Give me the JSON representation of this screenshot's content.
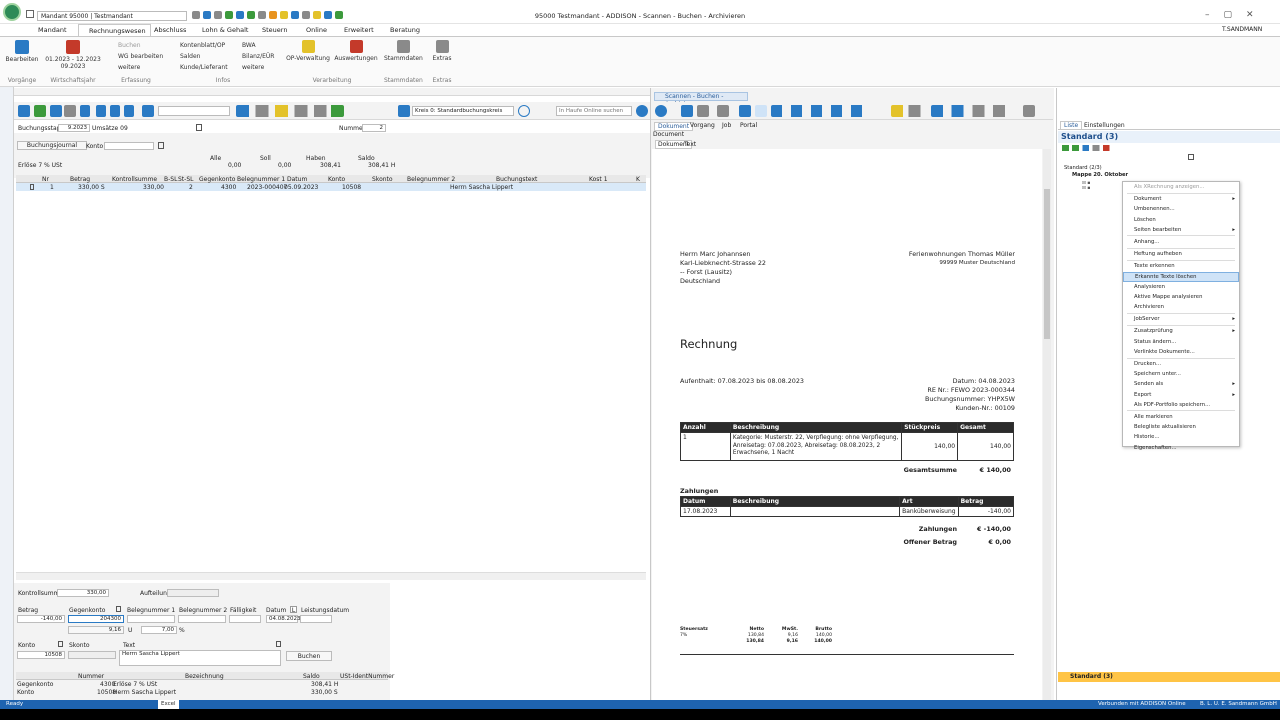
{
  "window": {
    "title": "95000 Testmandant - ADDISON - Scannen - Buchen - Archivieren",
    "mandant_field": "Mandant 95000  |  Testmandant",
    "user": "T.SANDMANN"
  },
  "tabs": [
    "Mandant",
    "Rechnungswesen",
    "Abschluss",
    "Lohn & Gehalt",
    "Steuern",
    "Online",
    "Erweitert",
    "Beratung"
  ],
  "ribbon": {
    "bearbeiten": "Bearbeiten",
    "vorgaenge": "Vorgänge",
    "period": "01.2023 - 12.2023",
    "period_sub": "09.2023",
    "wj": "Wirtschaftsjahr",
    "buchen": "Buchen",
    "wg": "WG bearbeiten",
    "weitere1": "weitere",
    "erfassung": "Erfassung",
    "kontenblatt": "Kontenblatt/OP",
    "salden": "Salden",
    "kunde": "Kunde/Lieferant",
    "bwa": "BWA",
    "bilanz": "Bilanz/EÜR",
    "weitere2": "weitere",
    "infos": "Infos",
    "opv": "OP-Verwaltung",
    "auswertungen": "Auswertungen",
    "verarbeitung": "Verarbeitung",
    "stammdaten": "Stammdaten",
    "stammdaten_grp": "Stammdaten",
    "extras": "Extras",
    "extras_grp": "Extras"
  },
  "left": {
    "kreis": "Kreis 0: Standardbuchungskreis",
    "search_placeholder": "In Haufe Online suchen",
    "stapel_label": "Buchungsstapel",
    "stapel_value": "9.2023",
    "stapel_name": "Umsätze 09",
    "nummer_label": "Nummer",
    "nummer_value": "2",
    "journal_btn": "Buchungsjournal",
    "konto_label": "Konto",
    "sum_headers": [
      "Alle",
      "Soll",
      "Haben",
      "Saldo"
    ],
    "sum_row_label": "Erlöse 7 % USt",
    "sum_values": [
      "0,00",
      "0,00",
      "308,41",
      "308,41 H"
    ],
    "cols": [
      "Nr",
      "Betrag",
      "Kontrollsumme",
      "B-SL",
      "St-SL",
      "Gegenkonto",
      "Belegnummer 1",
      "Datum",
      "Konto",
      "Skonto",
      "Belegnummer 2",
      "Buchungstext",
      "Kost 1",
      "K"
    ],
    "row": [
      "1",
      "330,00 S",
      "330,00",
      "2",
      "4300",
      "2023-000407",
      "05.09.2023",
      "10508",
      "",
      "",
      "Herrn Sascha Lippert"
    ],
    "kontrollsumme_label": "Kontrollsumme",
    "kontrollsumme_value": "330,00",
    "aufteilung_label": "Aufteilung",
    "form_labels": [
      "Betrag",
      "Gegenkonto",
      "Belegnummer 1",
      "Belegnummer 2",
      "Fälligkeit",
      "Datum",
      "L",
      "Leistungsdatum"
    ],
    "form_betrag": "-140,00",
    "form_gegenkonto": "204300",
    "form_datum": "04.08.2023",
    "form_ust": "9,16",
    "form_u": "U",
    "form_pct": "7,00",
    "form_pct_sign": "%",
    "konto_lbl": "Konto",
    "skonto_lbl": "Skonto",
    "text_lbl": "Text",
    "konto_val": "10508",
    "text_val": "Herrn Sascha Lippert",
    "buchen_btn": "Buchen",
    "info_headers": [
      "Nummer",
      "Bezeichnung",
      "Saldo",
      "USt-IdentNummer"
    ],
    "info_rows": [
      [
        "Gegenkonto",
        "4300",
        "Erlöse 7 % USt",
        "308,41 H"
      ],
      [
        "Konto",
        "10508",
        "Herrn Sascha Lippert",
        "330,00 S"
      ]
    ]
  },
  "doc": {
    "title": "Scannen - Buchen - Archivieren",
    "tabs": [
      "Dokument",
      "Vorgang",
      "Job",
      "Portal"
    ],
    "sub": "Document",
    "subtabs": [
      "Dokument",
      "Text"
    ],
    "to_name": "Herrn Marc Johannsen",
    "to_street": "Karl-Liebknecht-Strasse 22",
    "to_city": "-- Forst (Lausitz)",
    "to_country": "Deutschland",
    "from_name": "Ferienwohnungen Thomas Müller",
    "from_city": "99999 Muster Deutschland",
    "heading": "Rechnung",
    "stay": "Aufenthalt: 07.08.2023 bis 08.08.2023",
    "date": "Datum: 04.08.2023",
    "re_nr": "RE Nr.: FEWO 2023-000344",
    "buchungsnr": "Buchungsnummer: YHPX5W",
    "kunden": "Kunden-Nr.: 00109",
    "t_headers": [
      "Anzahl",
      "Beschreibung",
      "Stückpreis",
      "Gesamt"
    ],
    "t_row": [
      "1",
      "Kategorie: Musterstr. 22, Verpflegung: ohne Verpflegung, Anreisetag: 07.08.2023, Abreisetag: 08.08.2023, 2 Erwachsene, 1 Nacht",
      "140,00",
      "140,00"
    ],
    "gesamt_label": "Gesamtsumme",
    "gesamt": "€ 140,00",
    "zahlungen": "Zahlungen",
    "z_headers": [
      "Datum",
      "Beschreibung",
      "Art",
      "Betrag"
    ],
    "z_row": [
      "17.08.2023",
      "",
      "Banküberweisung",
      "-140,00"
    ],
    "zahl_label": "Zahlungen",
    "zahl_val": "€ -140,00",
    "offen_label": "Offener Betrag",
    "offen_val": "€ 0,00",
    "tax_headers": [
      "Steuersatz",
      "Netto",
      "MwSt.",
      "Brutto"
    ],
    "tax_row": [
      "7%",
      "130,84",
      "9,16",
      "140,00"
    ],
    "tax_total": [
      "",
      "130,84",
      "9,16",
      "140,00"
    ]
  },
  "right": {
    "tabs": [
      "Liste",
      "Einstellungen"
    ],
    "title": "Standard (3)",
    "tree_root": "Standard (2/3)",
    "tree_folder": "Mappe 20. Oktober",
    "bottom": "Standard (3)",
    "menu": [
      {
        "t": "Als XRechnung anzeigen...",
        "d": true
      },
      {
        "t": "sep"
      },
      {
        "t": "Dokument",
        "a": true
      },
      {
        "t": "Umbenennen..."
      },
      {
        "t": "Löschen"
      },
      {
        "t": "Seiten bearbeiten",
        "a": true
      },
      {
        "t": "sep"
      },
      {
        "t": "Anhang..."
      },
      {
        "t": "sep"
      },
      {
        "t": "Heftung aufheben"
      },
      {
        "t": "sep"
      },
      {
        "t": "Texte erkennen"
      },
      {
        "t": "Erkannte Texte löschen",
        "s": true
      },
      {
        "t": "Analysieren"
      },
      {
        "t": "Aktive Mappe analysieren"
      },
      {
        "t": "Archivieren"
      },
      {
        "t": "sep"
      },
      {
        "t": "JobServer",
        "a": true
      },
      {
        "t": "sep"
      },
      {
        "t": "Zusatzprüfung",
        "a": true
      },
      {
        "t": "Status ändern..."
      },
      {
        "t": "Verlinkte Dokumente..."
      },
      {
        "t": "sep"
      },
      {
        "t": "Drucken..."
      },
      {
        "t": "Speichern unter..."
      },
      {
        "t": "Senden als",
        "a": true
      },
      {
        "t": "Export",
        "a": true
      },
      {
        "t": "Als PDF-Portfolio speichern..."
      },
      {
        "t": "sep"
      },
      {
        "t": "Alle markieren"
      },
      {
        "t": "Belegliste aktualisieren"
      },
      {
        "t": "Historie..."
      },
      {
        "t": "Eigenschaften..."
      }
    ]
  },
  "status": {
    "ready": "Ready",
    "excel": "Excel",
    "connected": "Verbunden mit ADDISON Online",
    "company": "B. L. U. E. Sandmann GmbH"
  },
  "colors": {
    "accent": "#2a7ac4",
    "statusbar": "#1e63b0",
    "header_bg": "#f3f3f3"
  }
}
